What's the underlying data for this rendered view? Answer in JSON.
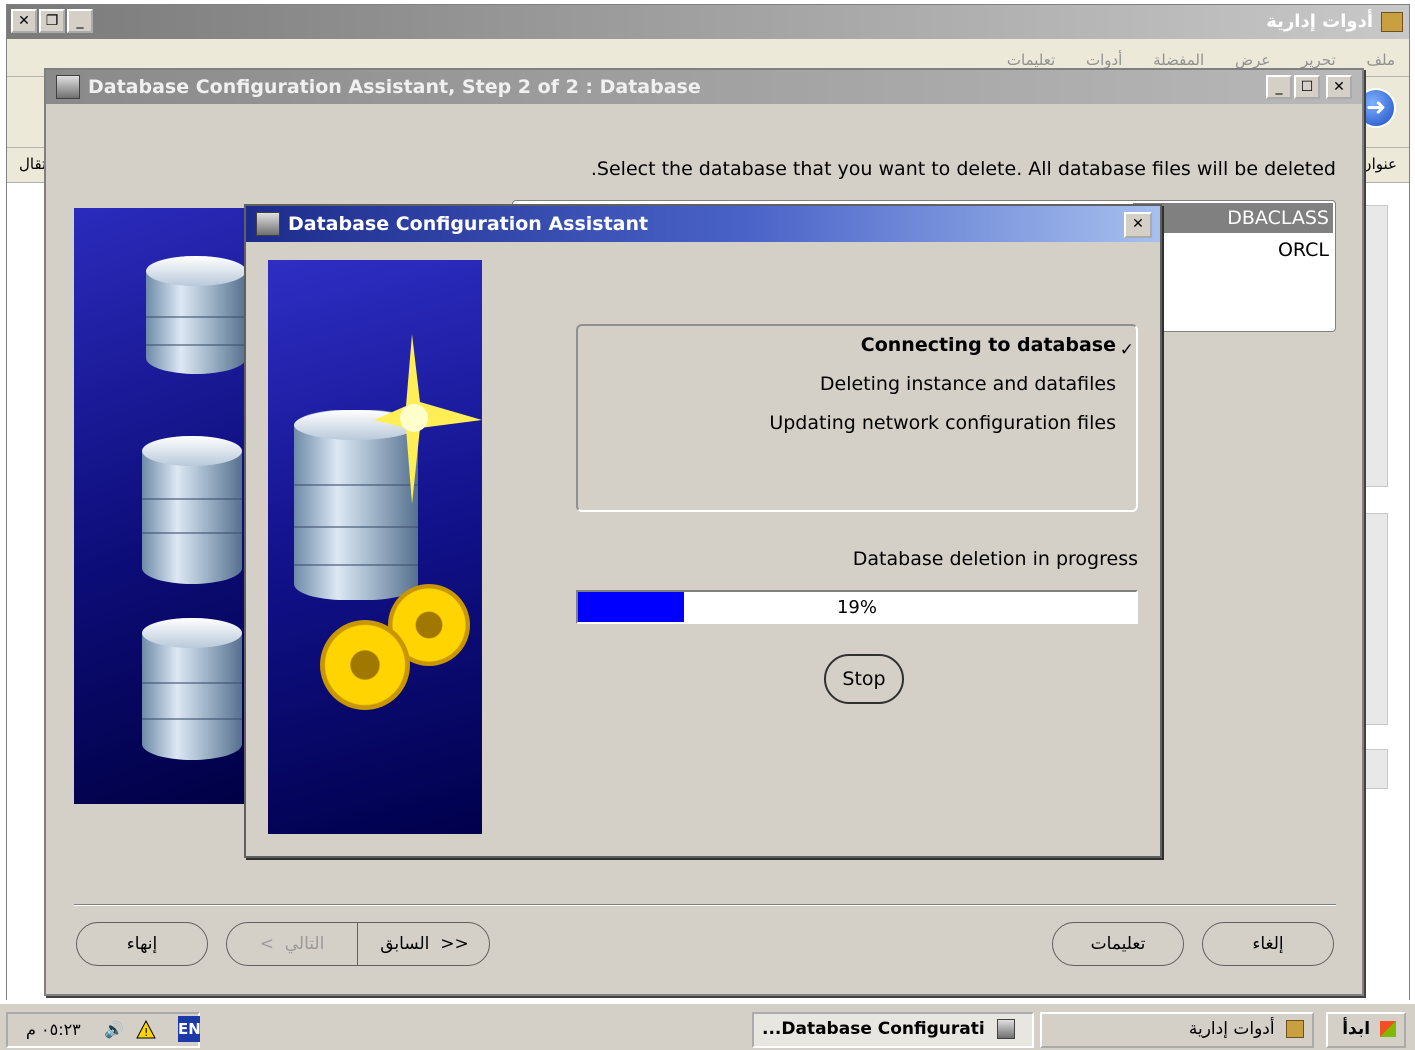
{
  "explorer": {
    "title": "أدوات إدارية",
    "menu": [
      "ملف",
      "تحرير",
      "عرض",
      "المفضلة",
      "أدوات",
      "تعليمات"
    ],
    "address_label": "عنوان",
    "go_label": "انتقال"
  },
  "dbca": {
    "title": "Database Configuration Assistant, Step 2 of 2 : Database",
    "instruction": ".Select the database that you want to delete. All database files will be deleted",
    "databases": [
      "DBACLASS",
      "ORCL"
    ],
    "selected_database": "DBACLASS",
    "buttons": {
      "finish": "إنهاء",
      "next": "التالي",
      "back": "السابق",
      "help": "تعليمات",
      "cancel": "إلغاء"
    }
  },
  "progress_dialog": {
    "title": "Database Configuration Assistant",
    "steps": [
      {
        "label": "Connecting to database",
        "active": true
      },
      {
        "label": "Deleting instance and datafiles",
        "active": false
      },
      {
        "label": "Updating network configuration files",
        "active": false
      }
    ],
    "status": "Database deletion in progress",
    "progress_percent": 19,
    "progress_label": "19%",
    "stop_label": "Stop"
  },
  "taskbar": {
    "start_label": "ابدأ",
    "tasks": [
      "أدوات إدارية",
      "...Database Configurati"
    ],
    "active_task": "...Database Configurati",
    "language": "EN",
    "clock": "٠٥:٢٣ م"
  },
  "colors": {
    "progress_fill": "#0000ff",
    "active_title": "#1d2c8c",
    "inactive_title": "#8a8a8a",
    "face": "#d4d0c8"
  }
}
